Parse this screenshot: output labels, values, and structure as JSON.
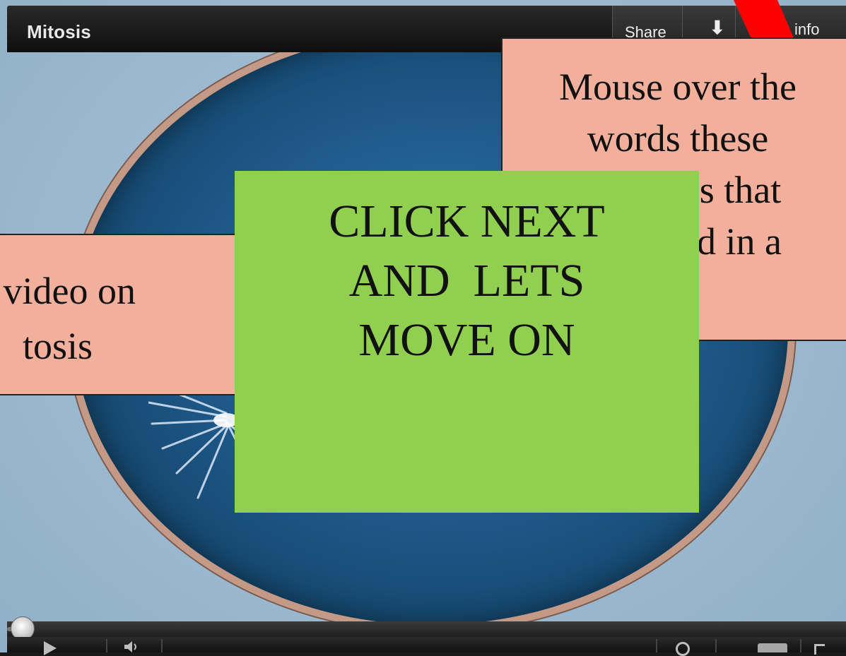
{
  "player": {
    "title": "Mitosis",
    "share_label": "Share",
    "more_label": "⬇",
    "info_label": "info",
    "progress_fraction": 0.02
  },
  "callouts": {
    "right_lines": [
      "Mouse over the",
      "words these",
      "ns that",
      "ed in a"
    ],
    "left_lines": [
      "t video on",
      "tosis"
    ]
  },
  "next_box": {
    "lines": [
      "CLICK NEXT",
      "AND  LETS",
      "MOVE ON"
    ]
  },
  "icons": {
    "play": "play-icon",
    "volume": "volume-icon",
    "clock": "clock-icon",
    "hd": "hd-icon",
    "fullscreen": "fullscreen-icon"
  },
  "colors": {
    "callout": "#f2b09c",
    "next_box": "#91cf50",
    "arrow": "#ff0000"
  }
}
